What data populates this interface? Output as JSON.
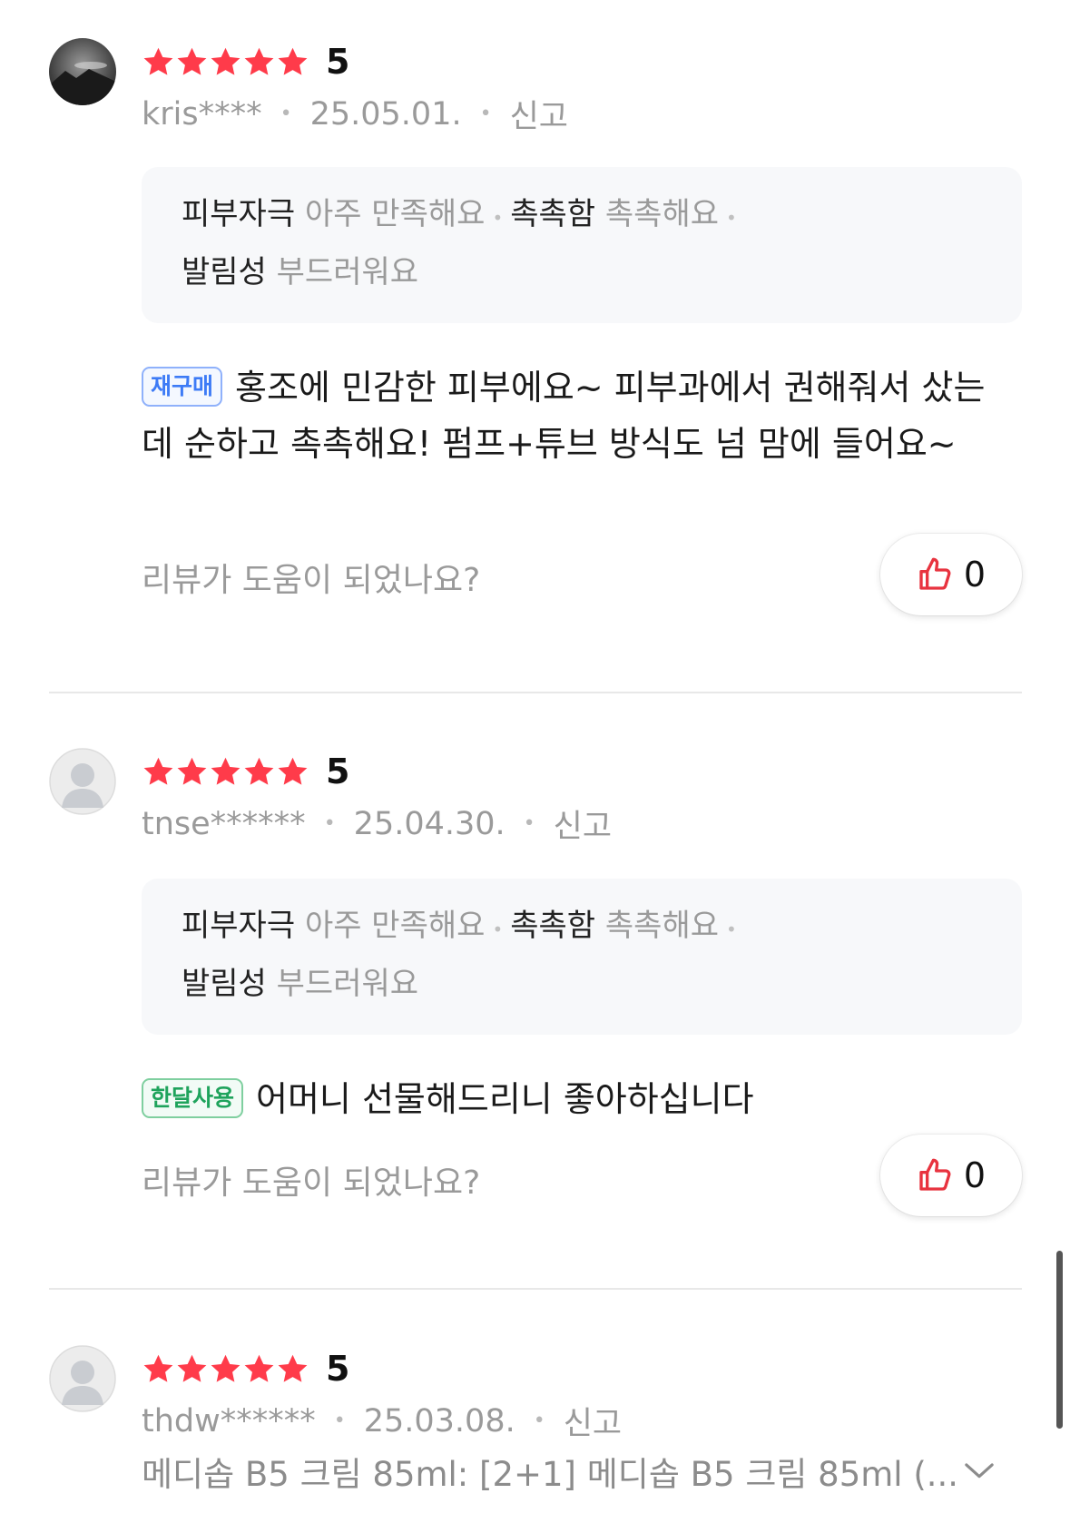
{
  "reviews": [
    {
      "avatar": "landscape-photo",
      "score": "5",
      "user": "kris****",
      "date": "25.05.01.",
      "report": "신고",
      "attributes": {
        "a1_name": "피부자극",
        "a1_value": "아주 만족해요",
        "a2_name": "촉촉함",
        "a2_value": "촉촉해요",
        "a3_name": "발림성",
        "a3_value": "부드러워요"
      },
      "tag": "재구매",
      "text": "홍조에 민감한 피부에요~ 피부과에서 권해줘서 샀는데 순하고 촉촉해요! 펌프+튜브 방식도 넘 맘에 들어요~",
      "helpful_prompt": "리뷰가 도움이 되었나요?",
      "likes": "0"
    },
    {
      "avatar": "default-user",
      "score": "5",
      "user": "tnse******",
      "date": "25.04.30.",
      "report": "신고",
      "attributes": {
        "a1_name": "피부자극",
        "a1_value": "아주 만족해요",
        "a2_name": "촉촉함",
        "a2_value": "촉촉해요",
        "a3_name": "발림성",
        "a3_value": "부드러워요"
      },
      "tag": "한달사용",
      "text": "어머니 선물해드리니 좋아하십니다",
      "helpful_prompt": "리뷰가 도움이 되었나요?",
      "likes": "0"
    },
    {
      "avatar": "default-user",
      "score": "5",
      "user": "thdw******",
      "date": "25.03.08.",
      "report": "신고",
      "option": "메디솝 B5 크림 85ml: [2+1] 메디솝 B5 크림 85ml (..."
    }
  ],
  "colors": {
    "star": "#ff3b4a",
    "like_icon": "#e8333f",
    "tag_blue": "#3d7bf6",
    "tag_green": "#1fa35c"
  }
}
